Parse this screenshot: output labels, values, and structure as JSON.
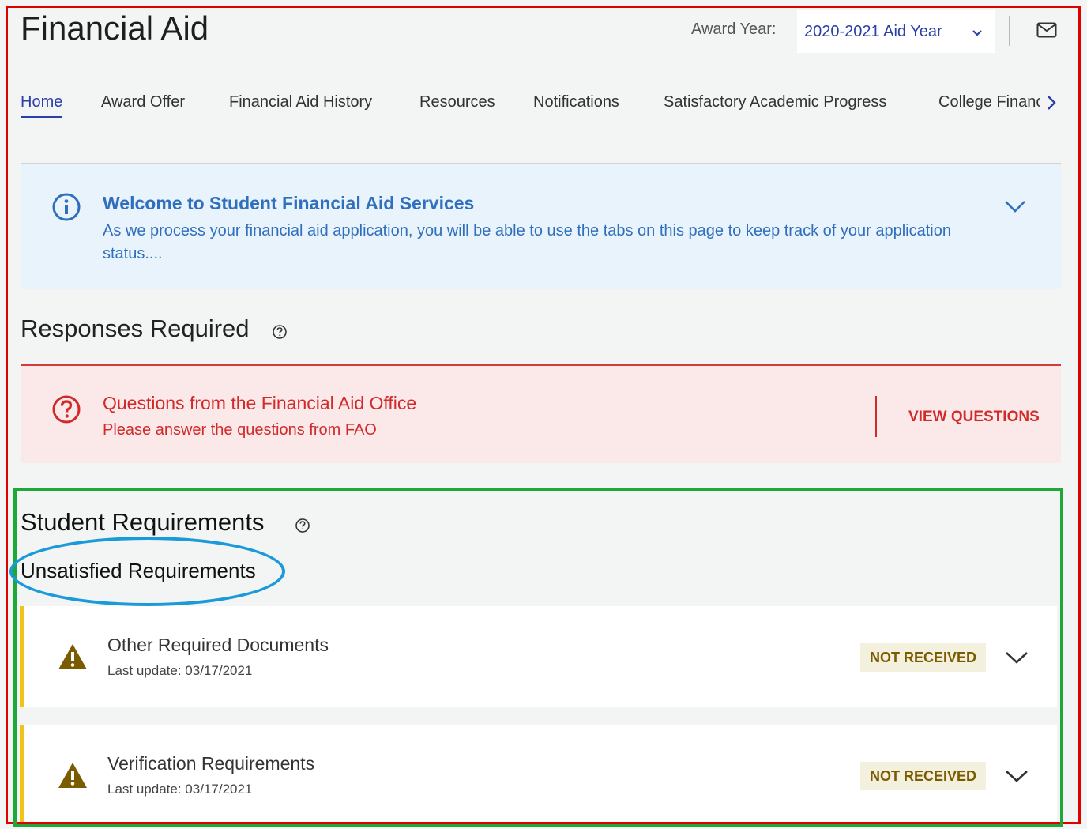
{
  "header": {
    "title": "Financial Aid",
    "award_year_label": "Award Year:",
    "award_year_value": "2020-2021 Aid Year"
  },
  "tabs": [
    {
      "label": "Home",
      "active": true
    },
    {
      "label": "Award Offer"
    },
    {
      "label": "Financial Aid History"
    },
    {
      "label": "Resources"
    },
    {
      "label": "Notifications"
    },
    {
      "label": "Satisfactory Academic Progress"
    },
    {
      "label": "College Financing"
    }
  ],
  "welcome": {
    "title": "Welcome to Student Financial Aid Services",
    "body": "As we process your financial aid application, you will be able to use the tabs on this page to keep track of your application status...."
  },
  "responses": {
    "heading": "Responses Required",
    "alert_title": "Questions from the Financial Aid Office",
    "alert_subtitle": "Please answer the questions from FAO",
    "button": "VIEW QUESTIONS"
  },
  "student_requirements": {
    "heading": "Student Requirements",
    "subheading": "Unsatisfied Requirements",
    "items": [
      {
        "name": "Other Required Documents",
        "updated": "Last update: 03/17/2021",
        "status": "NOT RECEIVED"
      },
      {
        "name": "Verification Requirements",
        "updated": "Last update: 03/17/2021",
        "status": "NOT RECEIVED"
      }
    ]
  },
  "colors": {
    "accent": "#2b3fa8",
    "info_blue": "#2f6fbd",
    "alert_red": "#d12a2a",
    "warning": "#f0c419",
    "annotation_red": "#e00000",
    "annotation_green": "#1fa83a",
    "annotation_blue": "#1a9ad8"
  },
  "icons": [
    "chevron-down-icon",
    "mail-icon",
    "chevron-right-icon",
    "info-icon",
    "help-icon",
    "question-icon",
    "warning-icon"
  ]
}
